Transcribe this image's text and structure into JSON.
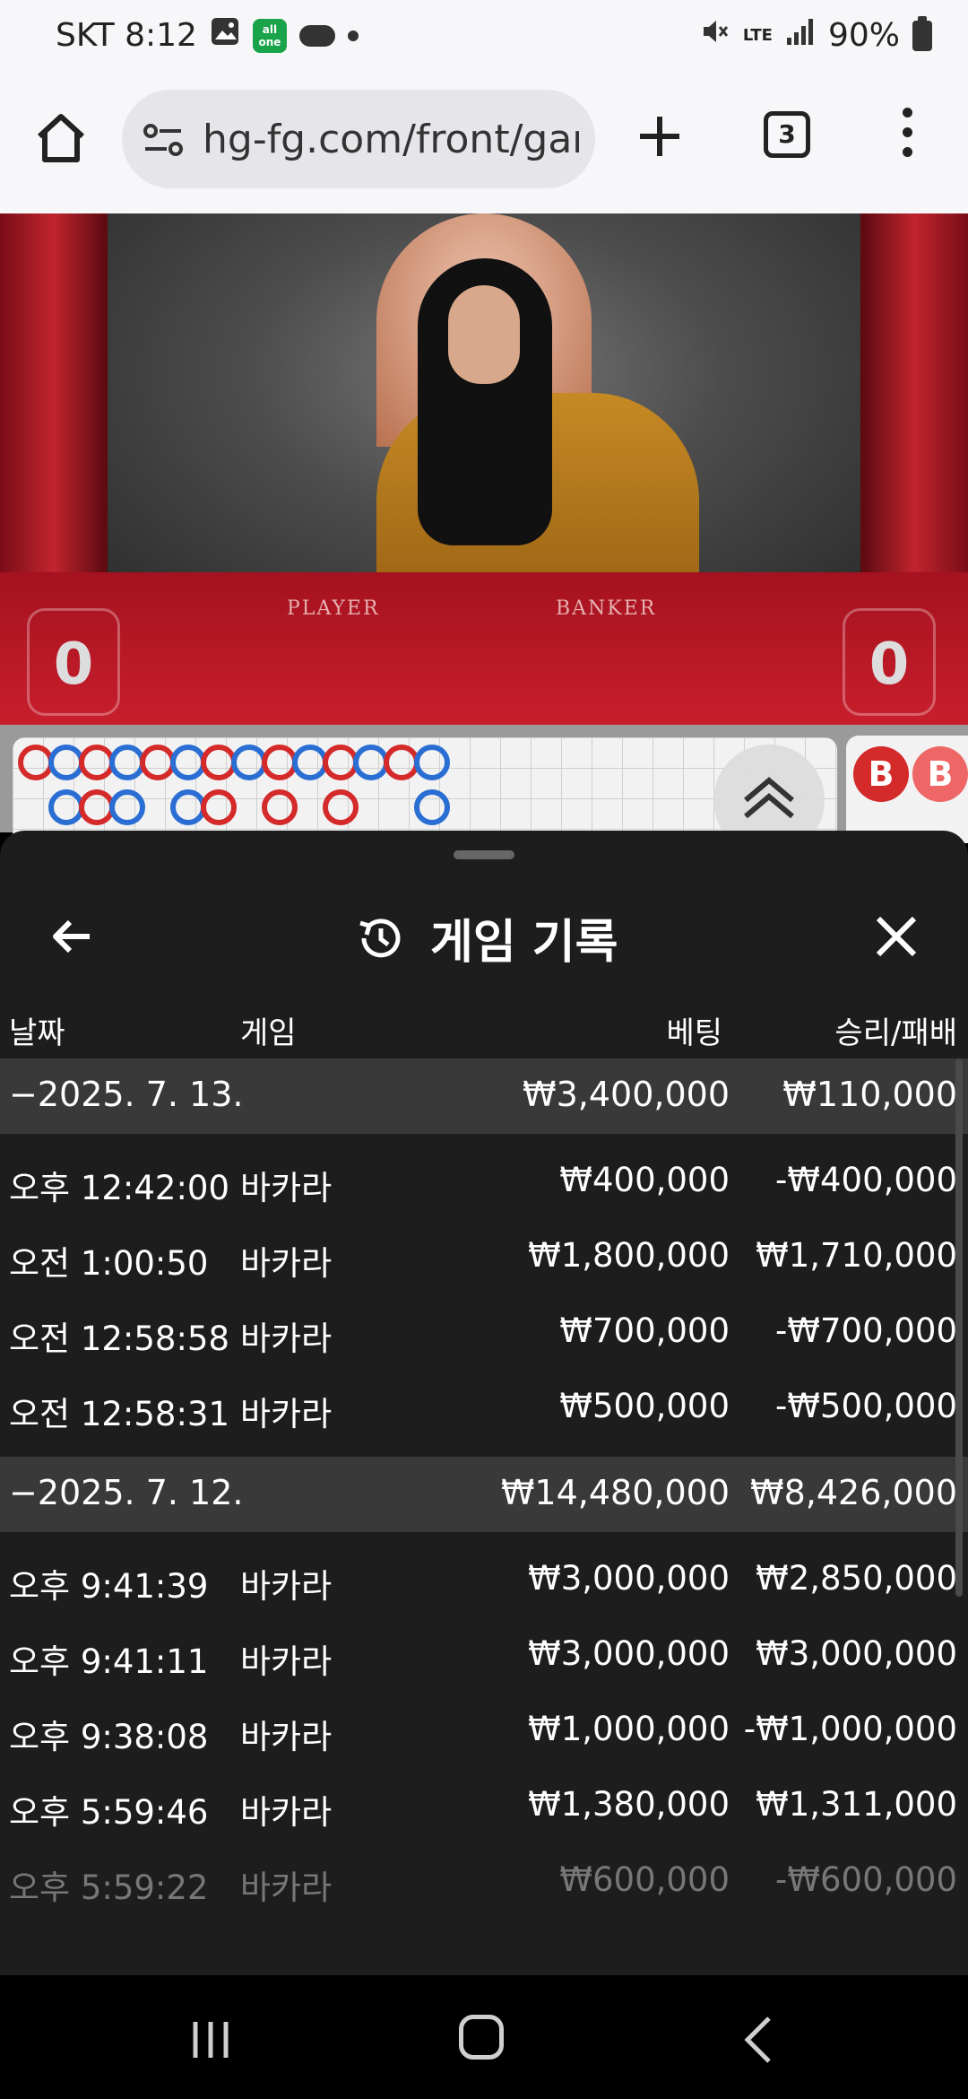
{
  "status_bar": {
    "carrier_time": "SKT 8:12",
    "network": "LTE",
    "battery": "90%"
  },
  "browser": {
    "url": "hg-fg.com/front/gam",
    "tab_count": "3"
  },
  "video": {
    "table_player_label": "PLAYER",
    "table_banker_label": "BANKER",
    "player_score": "0",
    "banker_score": "0"
  },
  "roadmap": {
    "side_labels": [
      "B",
      "B"
    ]
  },
  "history": {
    "title": "게임 기록",
    "columns": {
      "date": "날짜",
      "game": "게임",
      "bet": "베팅",
      "win_loss": "승리/패배"
    },
    "groups": [
      {
        "date": "−2025. 7. 13.",
        "total_bet": "₩3,400,000",
        "total_result": "₩110,000",
        "items": [
          {
            "time": "오후 12:42:00",
            "game": "바카라",
            "bet": "₩400,000",
            "result": "-₩400,000"
          },
          {
            "time": "오전 1:00:50",
            "game": "바카라",
            "bet": "₩1,800,000",
            "result": "₩1,710,000"
          },
          {
            "time": "오전 12:58:58",
            "game": "바카라",
            "bet": "₩700,000",
            "result": "-₩700,000"
          },
          {
            "time": "오전 12:58:31",
            "game": "바카라",
            "bet": "₩500,000",
            "result": "-₩500,000"
          }
        ]
      },
      {
        "date": "−2025. 7. 12.",
        "total_bet": "₩14,480,000",
        "total_result": "₩8,426,000",
        "items": [
          {
            "time": "오후 9:41:39",
            "game": "바카라",
            "bet": "₩3,000,000",
            "result": "₩2,850,000"
          },
          {
            "time": "오후 9:41:11",
            "game": "바카라",
            "bet": "₩3,000,000",
            "result": "₩3,000,000"
          },
          {
            "time": "오후 9:38:08",
            "game": "바카라",
            "bet": "₩1,000,000",
            "result": "-₩1,000,000"
          },
          {
            "time": "오후 5:59:46",
            "game": "바카라",
            "bet": "₩1,380,000",
            "result": "₩1,311,000"
          },
          {
            "time": "오후 5:59:22",
            "game": "바카라",
            "bet": "₩600,000",
            "result": "-₩600,000"
          }
        ]
      }
    ]
  }
}
